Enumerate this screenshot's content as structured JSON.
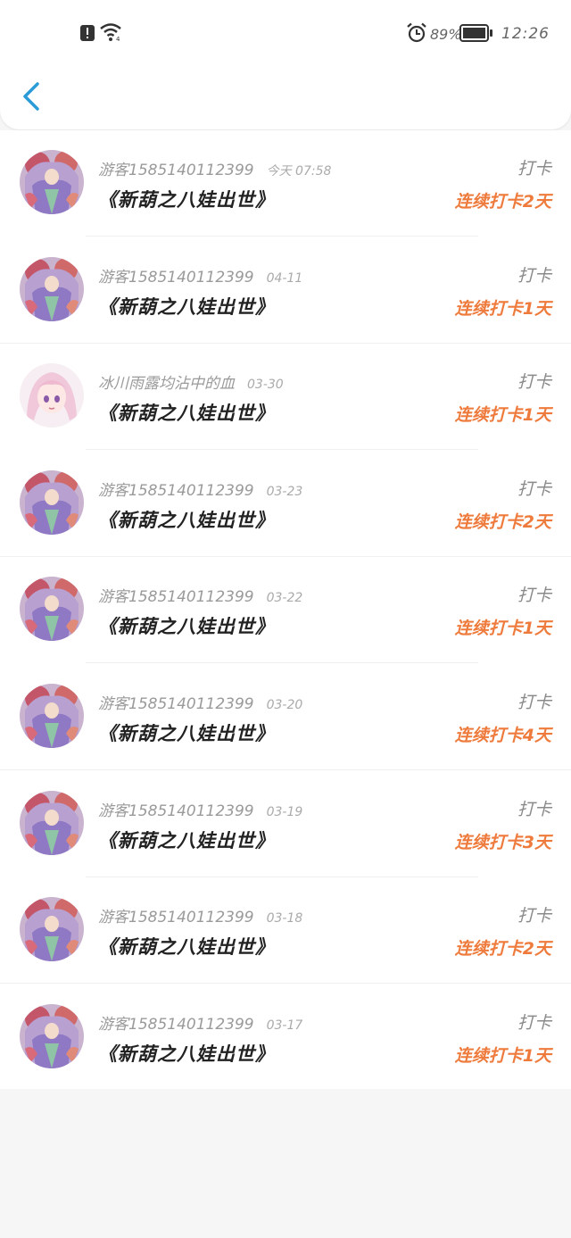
{
  "status_bar": {
    "battery_text": "89%",
    "time": "12:26",
    "icons": [
      "alert-icon",
      "wifi-icon",
      "alarm-icon",
      "battery-icon"
    ]
  },
  "header": {
    "back_icon": "chevron-left-icon",
    "accent_color": "#2a9bd8"
  },
  "colors": {
    "streak": "#ee7a3c",
    "muted": "#9a9a9a"
  },
  "records": [
    {
      "user": "游客1585140112399",
      "date": "今天  07:58",
      "book": "《新葫之八娃出世》",
      "tag": "打卡",
      "streak": "连续打卡2天",
      "avatar": "anime-avatar-red"
    },
    {
      "user": "游客1585140112399",
      "date": "04-11",
      "book": "《新葫之八娃出世》",
      "tag": "打卡",
      "streak": "连续打卡1天",
      "avatar": "anime-avatar-red"
    },
    {
      "user": "冰川雨露均沾中的血",
      "date": "03-30",
      "book": "《新葫之八娃出世》",
      "tag": "打卡",
      "streak": "连续打卡1天",
      "avatar": "anime-avatar-pink"
    },
    {
      "user": "游客1585140112399",
      "date": "03-23",
      "book": "《新葫之八娃出世》",
      "tag": "打卡",
      "streak": "连续打卡2天",
      "avatar": "anime-avatar-red"
    },
    {
      "user": "游客1585140112399",
      "date": "03-22",
      "book": "《新葫之八娃出世》",
      "tag": "打卡",
      "streak": "连续打卡1天",
      "avatar": "anime-avatar-red"
    },
    {
      "user": "游客1585140112399",
      "date": "03-20",
      "book": "《新葫之八娃出世》",
      "tag": "打卡",
      "streak": "连续打卡4天",
      "avatar": "anime-avatar-red"
    },
    {
      "user": "游客1585140112399",
      "date": "03-19",
      "book": "《新葫之八娃出世》",
      "tag": "打卡",
      "streak": "连续打卡3天",
      "avatar": "anime-avatar-red"
    },
    {
      "user": "游客1585140112399",
      "date": "03-18",
      "book": "《新葫之八娃出世》",
      "tag": "打卡",
      "streak": "连续打卡2天",
      "avatar": "anime-avatar-red"
    },
    {
      "user": "游客1585140112399",
      "date": "03-17",
      "book": "《新葫之八娃出世》",
      "tag": "打卡",
      "streak": "连续打卡1天",
      "avatar": "anime-avatar-red"
    }
  ]
}
